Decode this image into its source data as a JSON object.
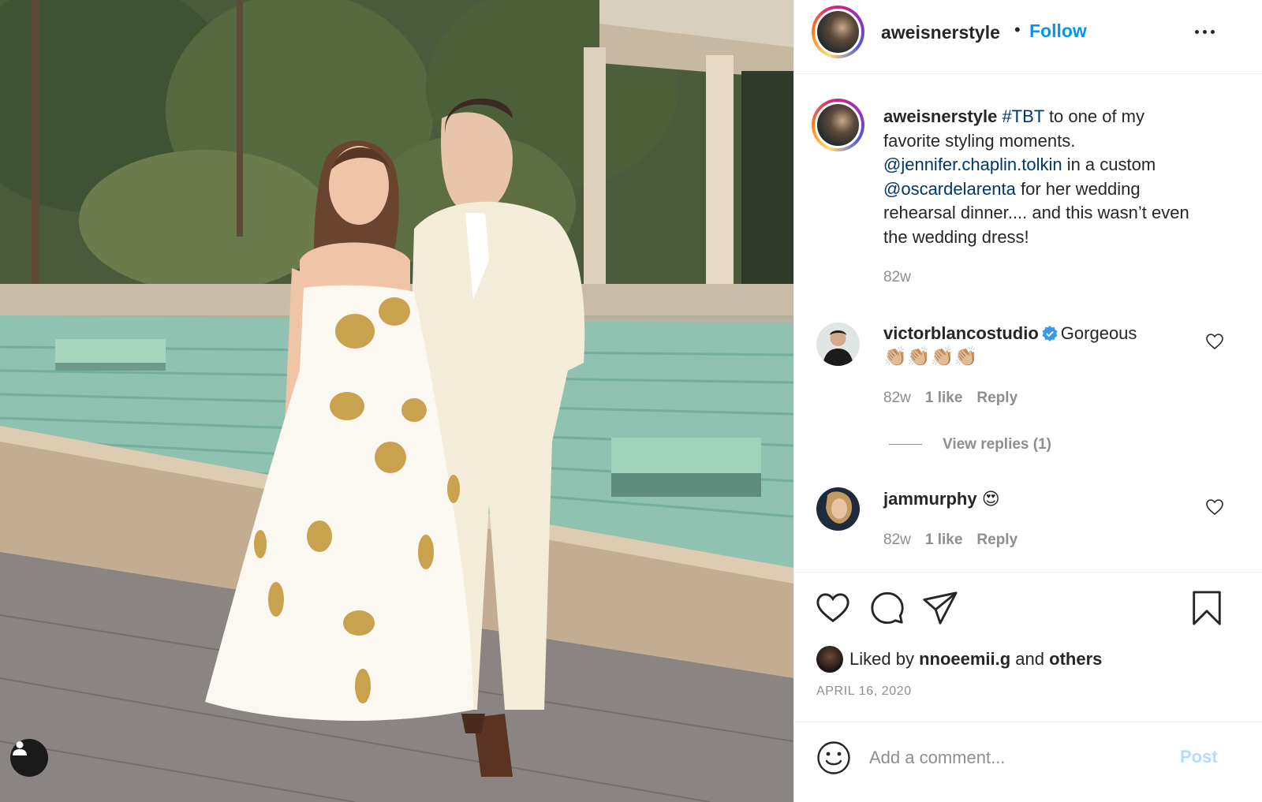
{
  "post": {
    "username": "aweisnerstyle",
    "separator": "•",
    "follow_label": "Follow",
    "more_icon": "more-horizontal-icon",
    "photo_user_tag_icon": "user-tag-icon"
  },
  "caption": {
    "username": "aweisnerstyle",
    "hashtag": "#TBT",
    "text_1": " to one of my favorite styling moments. ",
    "mention_1": "@jennifer.chaplin.tolkin",
    "text_2": " in a custom ",
    "mention_2": "@oscardelarenta",
    "text_3": " for her wedding rehearsal dinner.... and this wasn’t even the wedding dress!",
    "time": "82w"
  },
  "comments": [
    {
      "username": "victorblancostudio",
      "verified": true,
      "text": "Gorgeous",
      "emoji": "👏🏼👏🏼👏🏼👏🏼",
      "time": "82w",
      "likes": "1 like",
      "reply_label": "Reply",
      "view_replies": "View replies (1)"
    },
    {
      "username": "jammurphy",
      "verified": false,
      "text": "",
      "emoji": "😍",
      "time": "82w",
      "likes": "1 like",
      "reply_label": "Reply"
    }
  ],
  "actions": {
    "like_icon": "heart-icon",
    "comment_icon": "comment-icon",
    "share_icon": "paper-plane-icon",
    "save_icon": "bookmark-icon",
    "liked_by_prefix": "Liked by ",
    "liked_by_user": "nnoeemii.g",
    "liked_by_and": " and ",
    "liked_by_others": "others",
    "date": "APRIL 16, 2020"
  },
  "add_comment": {
    "placeholder": "Add a comment...",
    "post_label": "Post",
    "emoji_icon": "smile-icon"
  },
  "colors": {
    "link_blue": "#0095f6",
    "mention_blue": "#00376b",
    "text": "#262626",
    "muted": "#8e8e8e",
    "post_disabled": "#b3dbff",
    "verified": "#3897f0"
  }
}
